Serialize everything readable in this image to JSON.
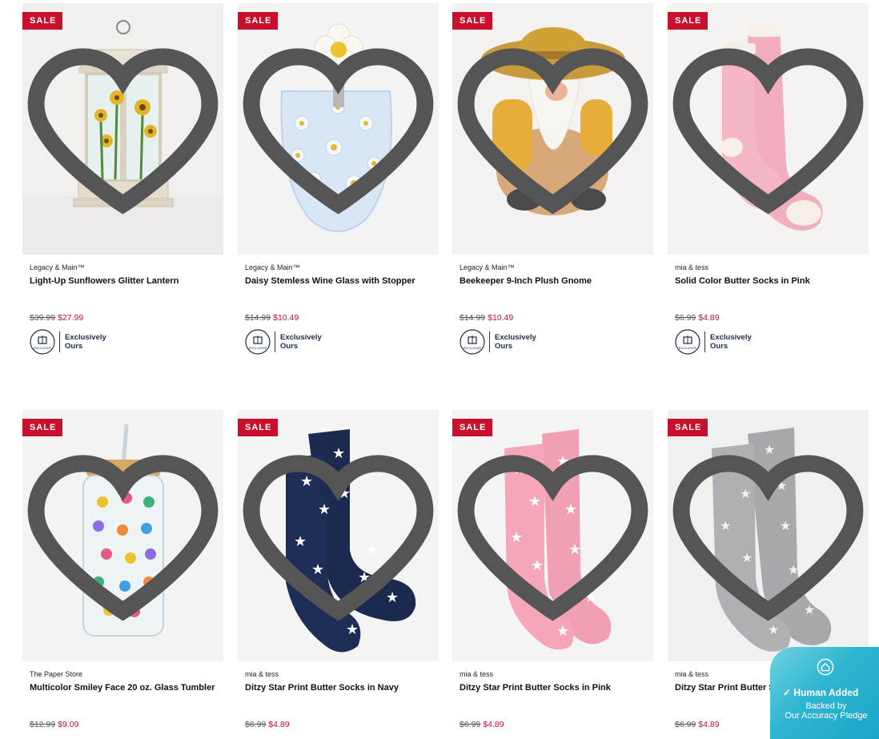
{
  "products": [
    {
      "badge": "SALE",
      "brand": "Legacy & Main™",
      "name": "Light-Up Sunflowers Glitter Lantern",
      "original_price": "$39.99",
      "sale_price": "$27.99",
      "exclusive_line1": "Exclusively",
      "exclusive_line2": "Ours",
      "badge_circle_text": "EXCLUSIVE",
      "image": "lantern"
    },
    {
      "badge": "SALE",
      "brand": "Legacy & Main™",
      "name": "Daisy Stemless Wine Glass with Stopper",
      "original_price": "$14.99",
      "sale_price": "$10.49",
      "exclusive_line1": "Exclusively",
      "exclusive_line2": "Ours",
      "badge_circle_text": "EXCLUSIVE",
      "image": "wine-glass"
    },
    {
      "badge": "SALE",
      "brand": "Legacy & Main™",
      "name": "Beekeeper 9-Inch Plush Gnome",
      "original_price": "$14.99",
      "sale_price": "$10.49",
      "exclusive_line1": "Exclusively",
      "exclusive_line2": "Ours",
      "badge_circle_text": "EXCLUSIVE",
      "image": "gnome"
    },
    {
      "badge": "SALE",
      "brand": "mia & tess",
      "name": "Solid Color Butter Socks in Pink",
      "original_price": "$6.99",
      "sale_price": "$4.89",
      "exclusive_line1": "Exclusively",
      "exclusive_line2": "Ours",
      "badge_circle_text": "EXCLUSIVE",
      "image": "pink-socks"
    },
    {
      "badge": "SALE",
      "brand": "The Paper Store",
      "name": "Multicolor Smiley Face 20 oz. Glass Tumbler",
      "original_price": "$12.99",
      "sale_price": "$9.09",
      "image": "tumbler"
    },
    {
      "badge": "SALE",
      "brand": "mia & tess",
      "name": "Ditzy Star Print Butter Socks in Navy",
      "original_price": "$6.99",
      "sale_price": "$4.89",
      "image": "star-socks-navy"
    },
    {
      "badge": "SALE",
      "brand": "mia & tess",
      "name": "Ditzy Star Print Butter Socks in Pink",
      "original_price": "$6.99",
      "sale_price": "$4.89",
      "image": "star-socks-pink"
    },
    {
      "badge": "SALE",
      "brand": "mia & tess",
      "name": "Ditzy Star Print Butter Socks in Grey",
      "original_price": "$6.99",
      "sale_price": "$4.89",
      "image": "star-socks-grey"
    }
  ],
  "accuracy_widget": {
    "title": "Human Added",
    "line1": "Backed by",
    "line2": "Our Accuracy Pledge"
  },
  "colors": {
    "sale_red": "#c8102e",
    "navy": "#1b2a4e",
    "pink": "#f2aebf",
    "grey": "#a8a8ac",
    "widget": "#2eb5d0"
  },
  "icons": {
    "wishlist": "heart-outline-icon",
    "exclusive": "gift-badge-icon",
    "widget": "house-icon"
  }
}
